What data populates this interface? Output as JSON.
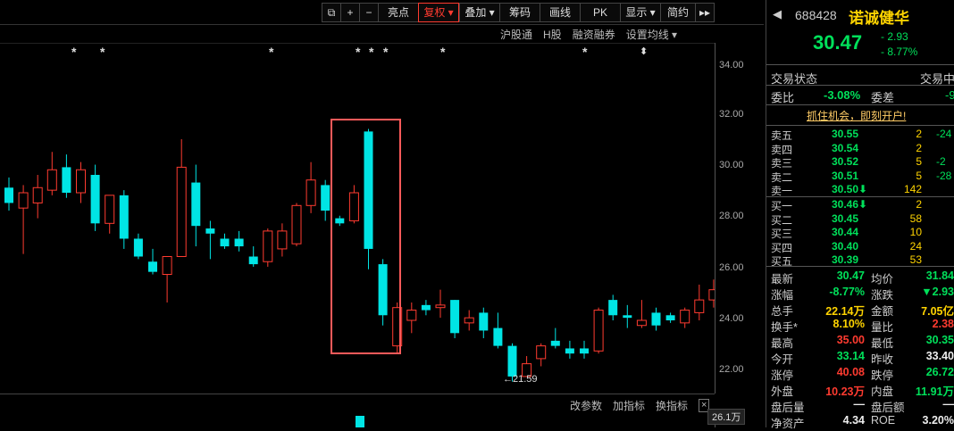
{
  "toolbar": {
    "items": [
      {
        "label": "⧉",
        "icon": "lock-icon"
      },
      {
        "label": "+"
      },
      {
        "label": "−"
      },
      {
        "label": "亮点"
      },
      {
        "label": "复权 ▾",
        "active": true
      },
      {
        "label": "叠加 ▾"
      },
      {
        "label": "筹码"
      },
      {
        "label": "画线"
      },
      {
        "label": "PK"
      },
      {
        "label": "显示 ▾"
      },
      {
        "label": "简约"
      },
      {
        "label": "▸▸"
      }
    ]
  },
  "subbar": {
    "items": [
      "沪股通",
      "H股",
      "融资融券",
      "设置均线 ▾"
    ]
  },
  "chart": {
    "y_axis": [
      "34.00",
      "32.00",
      "30.00",
      "28.00",
      "26.00",
      "24.00",
      "22.00"
    ],
    "low_marker": "←21.59",
    "volume_label": "26.1万",
    "stars": [
      "*",
      "*",
      "*",
      "*",
      "*",
      "*",
      "*",
      "*",
      "⬍"
    ]
  },
  "chart_data": {
    "type": "candlestick",
    "ylim": [
      21,
      35
    ],
    "up_color": "#ff3b30",
    "down_color": "#00e5e5",
    "candles": [
      {
        "o": 29.2,
        "h": 29.6,
        "l": 28.3,
        "c": 28.6
      },
      {
        "o": 28.4,
        "h": 29.3,
        "l": 26.6,
        "c": 29.0
      },
      {
        "o": 28.6,
        "h": 29.7,
        "l": 28.0,
        "c": 29.2
      },
      {
        "o": 29.1,
        "h": 30.6,
        "l": 28.9,
        "c": 29.9
      },
      {
        "o": 30.0,
        "h": 30.5,
        "l": 28.8,
        "c": 29.0
      },
      {
        "o": 29.0,
        "h": 30.2,
        "l": 28.6,
        "c": 29.9
      },
      {
        "o": 29.7,
        "h": 30.1,
        "l": 27.5,
        "c": 27.8
      },
      {
        "o": 27.8,
        "h": 28.9,
        "l": 27.4,
        "c": 28.9
      },
      {
        "o": 28.9,
        "h": 29.1,
        "l": 26.8,
        "c": 27.2
      },
      {
        "o": 27.2,
        "h": 27.4,
        "l": 26.4,
        "c": 26.5
      },
      {
        "o": 26.3,
        "h": 26.8,
        "l": 25.8,
        "c": 25.9
      },
      {
        "o": 25.8,
        "h": 26.5,
        "l": 24.7,
        "c": 26.5
      },
      {
        "o": 26.5,
        "h": 31.1,
        "l": 26.5,
        "c": 30.0
      },
      {
        "o": 29.4,
        "h": 30.1,
        "l": 26.9,
        "c": 27.7
      },
      {
        "o": 27.6,
        "h": 27.9,
        "l": 26.4,
        "c": 27.4
      },
      {
        "o": 27.2,
        "h": 27.4,
        "l": 26.8,
        "c": 26.9
      },
      {
        "o": 27.2,
        "h": 27.5,
        "l": 26.7,
        "c": 26.9
      },
      {
        "o": 26.5,
        "h": 26.9,
        "l": 26.1,
        "c": 26.2
      },
      {
        "o": 26.3,
        "h": 27.6,
        "l": 26.1,
        "c": 27.5
      },
      {
        "o": 26.8,
        "h": 27.8,
        "l": 26.5,
        "c": 27.5
      },
      {
        "o": 27.0,
        "h": 28.6,
        "l": 26.9,
        "c": 28.5
      },
      {
        "o": 28.5,
        "h": 30.2,
        "l": 28.2,
        "c": 29.5
      },
      {
        "o": 29.3,
        "h": 29.5,
        "l": 27.9,
        "c": 28.3
      },
      {
        "o": 28.0,
        "h": 28.1,
        "l": 27.7,
        "c": 27.8
      },
      {
        "o": 27.9,
        "h": 29.3,
        "l": 27.8,
        "c": 29.0
      },
      {
        "o": 31.4,
        "h": 31.5,
        "l": 26.0,
        "c": 26.8
      },
      {
        "o": 26.2,
        "h": 26.4,
        "l": 23.8,
        "c": 24.2
      },
      {
        "o": 23.0,
        "h": 24.7,
        "l": 22.7,
        "c": 24.5
      },
      {
        "o": 24.0,
        "h": 24.7,
        "l": 23.5,
        "c": 24.4
      },
      {
        "o": 24.6,
        "h": 24.8,
        "l": 24.2,
        "c": 24.4
      },
      {
        "o": 24.5,
        "h": 25.2,
        "l": 24.1,
        "c": 24.6
      },
      {
        "o": 24.8,
        "h": 24.8,
        "l": 23.3,
        "c": 23.5
      },
      {
        "o": 23.9,
        "h": 24.4,
        "l": 23.6,
        "c": 24.1
      },
      {
        "o": 24.3,
        "h": 24.5,
        "l": 23.3,
        "c": 23.6
      },
      {
        "o": 23.7,
        "h": 24.3,
        "l": 22.9,
        "c": 23.0
      },
      {
        "o": 23.0,
        "h": 23.1,
        "l": 21.6,
        "c": 21.8
      },
      {
        "o": 21.8,
        "h": 22.6,
        "l": 21.8,
        "c": 22.3
      },
      {
        "o": 22.5,
        "h": 23.1,
        "l": 22.2,
        "c": 23.0
      },
      {
        "o": 23.2,
        "h": 23.7,
        "l": 22.9,
        "c": 23.0
      },
      {
        "o": 22.9,
        "h": 23.2,
        "l": 22.5,
        "c": 22.7
      },
      {
        "o": 22.9,
        "h": 23.2,
        "l": 22.5,
        "c": 22.7
      },
      {
        "o": 22.8,
        "h": 24.5,
        "l": 22.7,
        "c": 24.4
      },
      {
        "o": 24.8,
        "h": 25.0,
        "l": 24.0,
        "c": 24.2
      },
      {
        "o": 24.2,
        "h": 24.6,
        "l": 23.7,
        "c": 24.1
      },
      {
        "o": 23.8,
        "h": 24.8,
        "l": 23.7,
        "c": 24.0
      },
      {
        "o": 24.3,
        "h": 24.5,
        "l": 23.6,
        "c": 23.8
      },
      {
        "o": 24.2,
        "h": 24.3,
        "l": 23.9,
        "c": 24.0
      },
      {
        "o": 23.9,
        "h": 24.5,
        "l": 23.7,
        "c": 24.4
      },
      {
        "o": 24.3,
        "h": 25.4,
        "l": 24.0,
        "c": 24.8
      },
      {
        "o": 24.8,
        "h": 25.6,
        "l": 24.5,
        "c": 25.2
      }
    ]
  },
  "stock": {
    "code": "688428",
    "name": "诺诚健华",
    "price": "30.47",
    "change": "- 2.93",
    "change_pct": "- 8.77%",
    "status_label": "交易状态",
    "status_value": "交易中",
    "webi_label": "委比",
    "webi_value": "-3.08%",
    "weicha_label": "委差",
    "weicha_value": "-9",
    "ad_text": "抓住机会，即刻开户!"
  },
  "order_book": {
    "asks": [
      {
        "label": "卖五",
        "price": "30.55",
        "vol": "2",
        "chg": "-24"
      },
      {
        "label": "卖四",
        "price": "30.54",
        "vol": "2",
        "chg": ""
      },
      {
        "label": "卖三",
        "price": "30.52",
        "vol": "5",
        "chg": "-2"
      },
      {
        "label": "卖二",
        "price": "30.51",
        "vol": "5",
        "chg": "-28"
      },
      {
        "label": "卖一",
        "price": "30.50⬇",
        "vol": "142",
        "chg": ""
      }
    ],
    "bids": [
      {
        "label": "买一",
        "price": "30.46⬇",
        "vol": "2",
        "chg": ""
      },
      {
        "label": "买二",
        "price": "30.45",
        "vol": "58",
        "chg": ""
      },
      {
        "label": "买三",
        "price": "30.44",
        "vol": "10",
        "chg": ""
      },
      {
        "label": "买四",
        "price": "30.40",
        "vol": "24",
        "chg": ""
      },
      {
        "label": "买五",
        "price": "30.39",
        "vol": "53",
        "chg": ""
      }
    ]
  },
  "stats": [
    {
      "l1": "最新",
      "v1": "30.47",
      "c1": "green",
      "l2": "均价",
      "v2": "31.84",
      "c2": "green"
    },
    {
      "l1": "涨幅",
      "v1": "-8.77%",
      "c1": "green",
      "l2": "涨跌",
      "v2": "▼2.93",
      "c2": "green"
    },
    {
      "l1": "总手",
      "v1": "22.14万",
      "c1": "yellow",
      "l2": "金额",
      "v2": "7.05亿",
      "c2": "yellow"
    },
    {
      "l1": "换手*",
      "v1": "8.10%",
      "c1": "yellow",
      "l2": "量比",
      "v2": "2.38",
      "c2": "red"
    },
    {
      "l1": "最高",
      "v1": "35.00",
      "c1": "red",
      "l2": "最低",
      "v2": "30.35",
      "c2": "green"
    },
    {
      "l1": "今开",
      "v1": "33.14",
      "c1": "green",
      "l2": "昨收",
      "v2": "33.40",
      "c2": "white"
    },
    {
      "l1": "涨停",
      "v1": "40.08",
      "c1": "red",
      "l2": "跌停",
      "v2": "26.72",
      "c2": "green"
    },
    {
      "l1": "外盘",
      "v1": "10.23万",
      "c1": "red",
      "l2": "内盘",
      "v2": "11.91万",
      "c2": "green"
    },
    {
      "l1": "盘后量",
      "v1": "—",
      "c1": "white",
      "l2": "盘后额",
      "v2": "—",
      "c2": "white"
    },
    {
      "l1": "净资产",
      "v1": "4.34",
      "c1": "white",
      "l2": "ROE",
      "v2": "3.20%",
      "c2": "white"
    }
  ],
  "bottom_bar": {
    "items": [
      "改参数",
      "加指标",
      "换指标"
    ],
    "close": "×"
  }
}
